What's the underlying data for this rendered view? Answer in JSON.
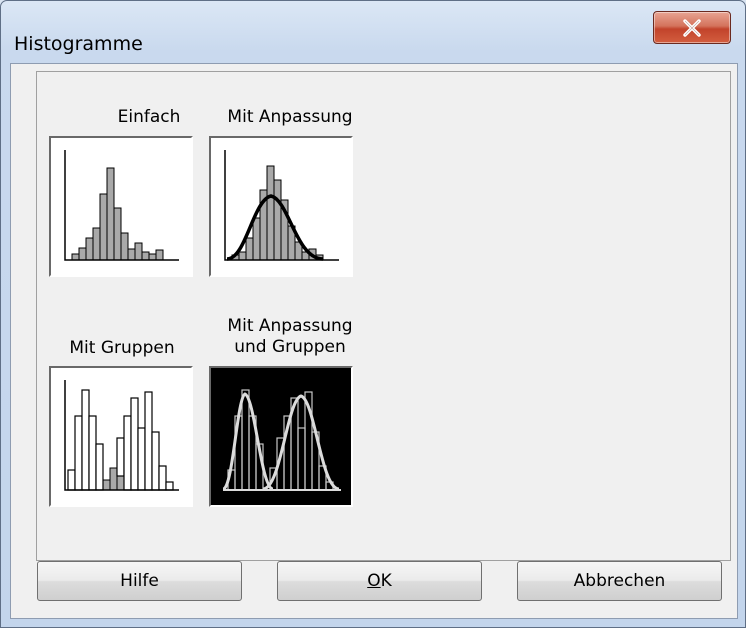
{
  "window": {
    "title": "Histogramme",
    "close_glyph": "X"
  },
  "options": [
    {
      "id": "einfach",
      "label": "Einfach",
      "selected": false,
      "icon": "simple-histogram-icon"
    },
    {
      "id": "mit-anpassung",
      "label": "Mit Anpassung",
      "selected": false,
      "icon": "fitted-histogram-icon"
    },
    {
      "id": "mit-gruppen",
      "label": "Mit Gruppen",
      "selected": false,
      "icon": "grouped-histogram-icon"
    },
    {
      "id": "mit-anpassung-und-gruppen",
      "label_line1": "Mit Anpassung",
      "label_line2": "und Gruppen",
      "selected": true,
      "icon": "fitted-grouped-histogram-icon"
    }
  ],
  "buttons": {
    "help": "Hilfe",
    "ok_mnemonic": "O",
    "ok_rest": "K",
    "cancel": "Abbrechen"
  },
  "colors": {
    "selection_background": "#000000",
    "close_button": "#c2432b",
    "bar_fill": "#a9a9a9"
  }
}
